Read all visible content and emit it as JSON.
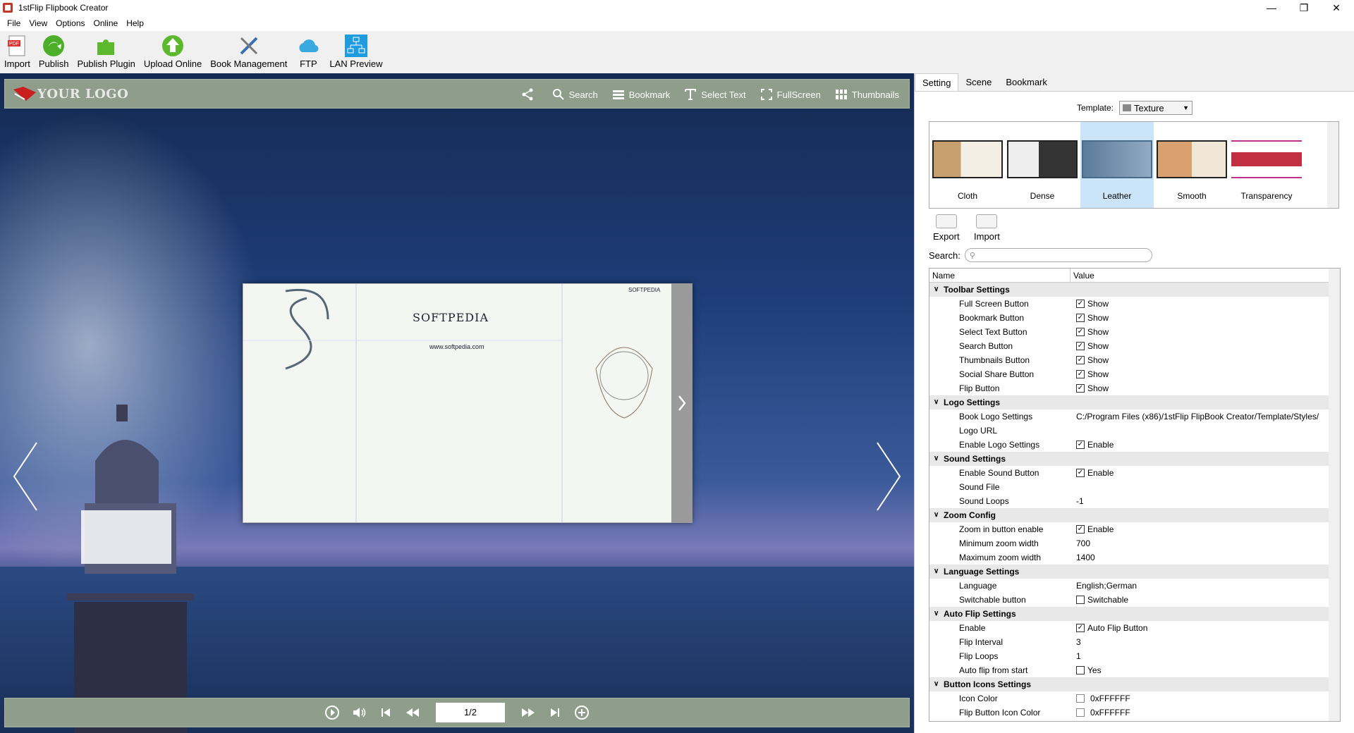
{
  "window": {
    "title": "1stFlip Flipbook Creator"
  },
  "menu": [
    "File",
    "View",
    "Options",
    "Online",
    "Help"
  ],
  "toolbar": {
    "import": "Import",
    "publish": "Publish",
    "publish_plugin": "Publish Plugin",
    "upload_online": "Upload Online",
    "book_management": "Book Management",
    "ftp": "FTP",
    "lan_preview": "LAN Preview"
  },
  "viewer": {
    "logo": "YOUR LOGO",
    "search": "Search",
    "bookmark": "Bookmark",
    "select_text": "Select Text",
    "fullscreen": "FullScreen",
    "thumbnails": "Thumbnails",
    "book_title": "SOFTPEDIA",
    "book_url": "www.softpedia.com",
    "book_brand": "SOFTPEDIA",
    "page_indicator": "1/2"
  },
  "panel": {
    "tabs": [
      "Setting",
      "Scene",
      "Bookmark"
    ],
    "template_label": "Template:",
    "template_value": "Texture",
    "templates": [
      "Cloth",
      "Dense",
      "Leather",
      "Smooth",
      "Transparency"
    ],
    "export": "Export",
    "import": "Import",
    "search_label": "Search:",
    "grid_head": {
      "name": "Name",
      "value": "Value"
    },
    "rows": [
      {
        "type": "cat",
        "name": "Toolbar Settings"
      },
      {
        "type": "chk",
        "name": "Full Screen Button",
        "value": "Show",
        "checked": true
      },
      {
        "type": "chk",
        "name": "Bookmark Button",
        "value": "Show",
        "checked": true
      },
      {
        "type": "chk",
        "name": "Select Text Button",
        "value": "Show",
        "checked": true
      },
      {
        "type": "chk",
        "name": "Search Button",
        "value": "Show",
        "checked": true
      },
      {
        "type": "chk",
        "name": "Thumbnails Button",
        "value": "Show",
        "checked": true
      },
      {
        "type": "chk",
        "name": "Social Share Button",
        "value": "Show",
        "checked": true
      },
      {
        "type": "chk",
        "name": "Flip Button",
        "value": "Show",
        "checked": true
      },
      {
        "type": "cat",
        "name": "Logo Settings"
      },
      {
        "type": "txt",
        "name": "Book Logo Settings",
        "value": "C:/Program Files (x86)/1stFlip FlipBook Creator/Template/Styles/"
      },
      {
        "type": "txt",
        "name": "Logo URL",
        "value": ""
      },
      {
        "type": "chk",
        "name": "Enable Logo Settings",
        "value": "Enable",
        "checked": true
      },
      {
        "type": "cat",
        "name": "Sound Settings"
      },
      {
        "type": "chk",
        "name": "Enable Sound Button",
        "value": "Enable",
        "checked": true
      },
      {
        "type": "txt",
        "name": "Sound File",
        "value": ""
      },
      {
        "type": "txt",
        "name": "Sound Loops",
        "value": "-1"
      },
      {
        "type": "cat",
        "name": "Zoom Config"
      },
      {
        "type": "chk",
        "name": "Zoom in button enable",
        "value": "Enable",
        "checked": true
      },
      {
        "type": "txt",
        "name": "Minimum zoom width",
        "value": "700"
      },
      {
        "type": "txt",
        "name": "Maximum zoom width",
        "value": "1400"
      },
      {
        "type": "cat",
        "name": "Language Settings"
      },
      {
        "type": "txt",
        "name": "Language",
        "value": "English;German"
      },
      {
        "type": "chk",
        "name": "Switchable button",
        "value": "Switchable",
        "checked": false
      },
      {
        "type": "cat",
        "name": "Auto Flip Settings"
      },
      {
        "type": "chk",
        "name": "Enable",
        "value": "Auto Flip Button",
        "checked": true
      },
      {
        "type": "txt",
        "name": "Flip Interval",
        "value": "3"
      },
      {
        "type": "txt",
        "name": "Flip Loops",
        "value": "1"
      },
      {
        "type": "chk",
        "name": "Auto flip from start",
        "value": "Yes",
        "checked": false
      },
      {
        "type": "cat",
        "name": "Button Icons Settings"
      },
      {
        "type": "col",
        "name": "Icon Color",
        "value": "0xFFFFFF"
      },
      {
        "type": "col",
        "name": "Flip Button Icon Color",
        "value": "0xFFFFFF"
      }
    ]
  }
}
